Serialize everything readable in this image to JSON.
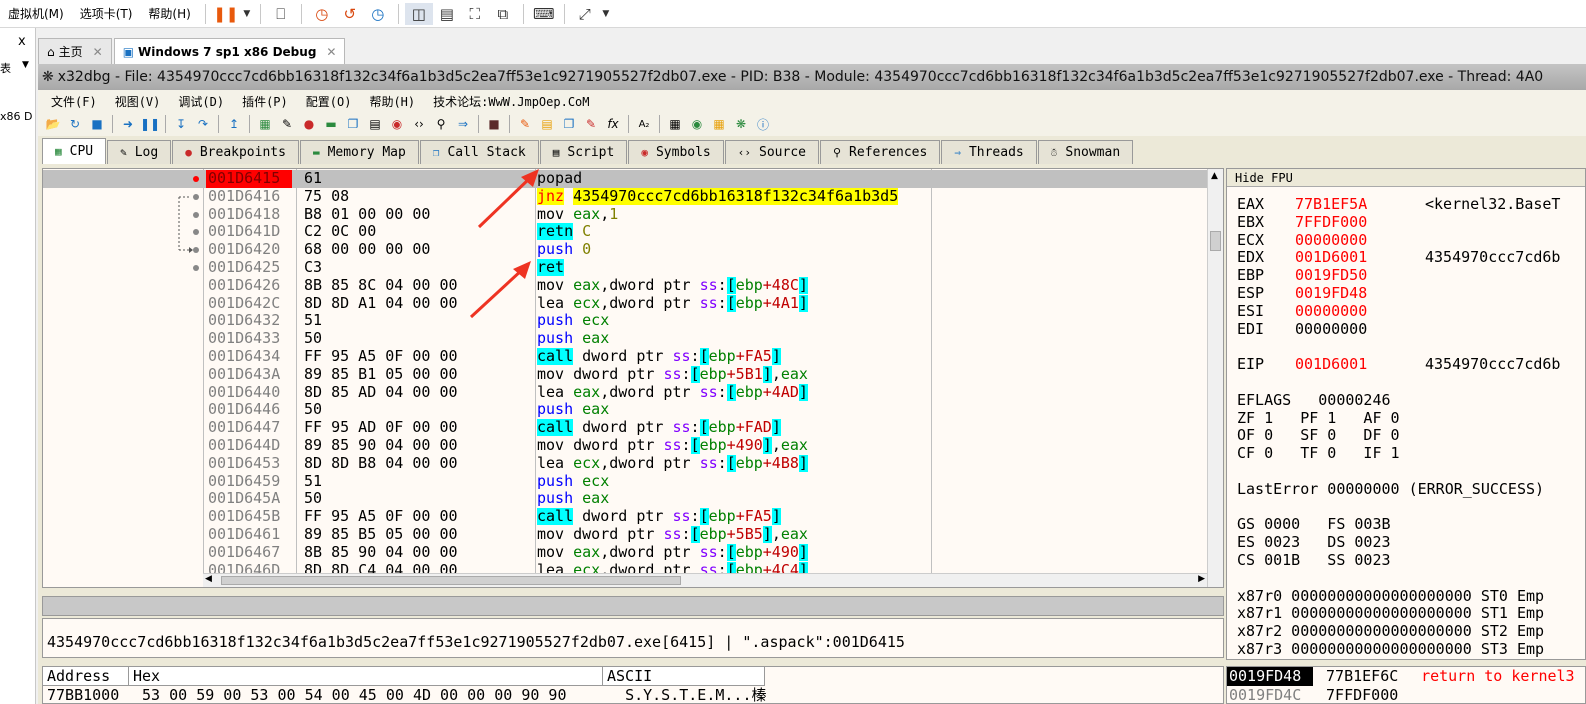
{
  "vm": {
    "menu": [
      "虚拟机(M)",
      "选项卡(T)",
      "帮助(H)"
    ],
    "tabs": [
      {
        "label": "主页"
      },
      {
        "label": "Windows 7 sp1 x86 Debug"
      }
    ],
    "left_labels": [
      "x",
      "表",
      "x86 D"
    ]
  },
  "window": {
    "title": "x32dbg - File: 4354970ccc7cd6bb16318f132c34f6a1b3d5c2ea7ff53e1c9271905527f2db07.exe - PID: B38 - Module: 4354970ccc7cd6bb16318f132c34f6a1b3d5c2ea7ff53e1c9271905527f2db07.exe - Thread: 4A0"
  },
  "menu": [
    "文件(F)",
    "视图(V)",
    "调试(D)",
    "插件(P)",
    "配置(O)",
    "帮助(H)",
    "技术论坛:WwW.JmpOep.CoM"
  ],
  "tabs": [
    {
      "label": "CPU",
      "active": true
    },
    {
      "label": "Log"
    },
    {
      "label": "Breakpoints"
    },
    {
      "label": "Memory Map"
    },
    {
      "label": "Call Stack"
    },
    {
      "label": "Script"
    },
    {
      "label": "Symbols"
    },
    {
      "label": "Source"
    },
    {
      "label": "References"
    },
    {
      "label": "Threads"
    },
    {
      "label": "Snowman"
    }
  ],
  "disasm": [
    {
      "addr": "001D6415",
      "bytes": "61",
      "parts": [
        [
          "op",
          "popad"
        ]
      ],
      "current": true
    },
    {
      "addr": "001D6416",
      "bytes": "75 08",
      "parts": [
        [
          "jcc",
          "jnz"
        ],
        [
          "sp",
          " "
        ],
        [
          "tgt",
          "4354970ccc7cd6bb16318f132c34f6a1b3d5"
        ]
      ]
    },
    {
      "addr": "001D6418",
      "bytes": "B8 01 00 00 00",
      "parts": [
        [
          "op",
          "mov "
        ],
        [
          "reg",
          "eax"
        ],
        [
          "op",
          ","
        ],
        [
          "imm",
          "1"
        ]
      ]
    },
    {
      "addr": "001D641D",
      "bytes": "C2 0C 00",
      "parts": [
        [
          "ret",
          "retn"
        ],
        [
          "op",
          " "
        ],
        [
          "imm",
          "C"
        ]
      ]
    },
    {
      "addr": "001D6420",
      "bytes": "68 00 00 00 00",
      "parts": [
        [
          "push",
          "push"
        ],
        [
          "op",
          " "
        ],
        [
          "imm",
          "0"
        ]
      ]
    },
    {
      "addr": "001D6425",
      "bytes": "C3",
      "parts": [
        [
          "ret",
          "ret"
        ]
      ]
    },
    {
      "addr": "001D6426",
      "bytes": "8B 85 8C 04 00 00",
      "parts": [
        [
          "op",
          "mov "
        ],
        [
          "reg",
          "eax"
        ],
        [
          "op",
          ",dword ptr "
        ],
        [
          "seg",
          "ss"
        ],
        [
          "op",
          ":"
        ],
        [
          "brk",
          "["
        ],
        [
          "reg",
          "ebp"
        ],
        [
          "off",
          "+48C"
        ],
        [
          "brk",
          "]"
        ]
      ]
    },
    {
      "addr": "001D642C",
      "bytes": "8D 8D A1 04 00 00",
      "parts": [
        [
          "op",
          "lea "
        ],
        [
          "reg",
          "ecx"
        ],
        [
          "op",
          ",dword ptr "
        ],
        [
          "seg",
          "ss"
        ],
        [
          "op",
          ":"
        ],
        [
          "brk",
          "["
        ],
        [
          "reg",
          "ebp"
        ],
        [
          "off",
          "+4A1"
        ],
        [
          "brk",
          "]"
        ]
      ]
    },
    {
      "addr": "001D6432",
      "bytes": "51",
      "parts": [
        [
          "push",
          "push"
        ],
        [
          "op",
          " "
        ],
        [
          "reg",
          "ecx"
        ]
      ]
    },
    {
      "addr": "001D6433",
      "bytes": "50",
      "parts": [
        [
          "push",
          "push"
        ],
        [
          "op",
          " "
        ],
        [
          "reg",
          "eax"
        ]
      ]
    },
    {
      "addr": "001D6434",
      "bytes": "FF 95 A5 0F 00 00",
      "parts": [
        [
          "call",
          "call"
        ],
        [
          "op",
          " dword ptr "
        ],
        [
          "seg",
          "ss"
        ],
        [
          "op",
          ":"
        ],
        [
          "brk",
          "["
        ],
        [
          "reg",
          "ebp"
        ],
        [
          "off",
          "+FA5"
        ],
        [
          "brk",
          "]"
        ]
      ]
    },
    {
      "addr": "001D643A",
      "bytes": "89 85 B1 05 00 00",
      "parts": [
        [
          "op",
          "mov dword ptr "
        ],
        [
          "seg",
          "ss"
        ],
        [
          "op",
          ":"
        ],
        [
          "brk",
          "["
        ],
        [
          "reg",
          "ebp"
        ],
        [
          "off",
          "+5B1"
        ],
        [
          "brk",
          "]"
        ],
        [
          "op",
          ","
        ],
        [
          "reg",
          "eax"
        ]
      ]
    },
    {
      "addr": "001D6440",
      "bytes": "8D 85 AD 04 00 00",
      "parts": [
        [
          "op",
          "lea "
        ],
        [
          "reg",
          "eax"
        ],
        [
          "op",
          ",dword ptr "
        ],
        [
          "seg",
          "ss"
        ],
        [
          "op",
          ":"
        ],
        [
          "brk",
          "["
        ],
        [
          "reg",
          "ebp"
        ],
        [
          "off",
          "+4AD"
        ],
        [
          "brk",
          "]"
        ]
      ]
    },
    {
      "addr": "001D6446",
      "bytes": "50",
      "parts": [
        [
          "push",
          "push"
        ],
        [
          "op",
          " "
        ],
        [
          "reg",
          "eax"
        ]
      ]
    },
    {
      "addr": "001D6447",
      "bytes": "FF 95 AD 0F 00 00",
      "parts": [
        [
          "call",
          "call"
        ],
        [
          "op",
          " dword ptr "
        ],
        [
          "seg",
          "ss"
        ],
        [
          "op",
          ":"
        ],
        [
          "brk",
          "["
        ],
        [
          "reg",
          "ebp"
        ],
        [
          "off",
          "+FAD"
        ],
        [
          "brk",
          "]"
        ]
      ]
    },
    {
      "addr": "001D644D",
      "bytes": "89 85 90 04 00 00",
      "parts": [
        [
          "op",
          "mov dword ptr "
        ],
        [
          "seg",
          "ss"
        ],
        [
          "op",
          ":"
        ],
        [
          "brk",
          "["
        ],
        [
          "reg",
          "ebp"
        ],
        [
          "off",
          "+490"
        ],
        [
          "brk",
          "]"
        ],
        [
          "op",
          ","
        ],
        [
          "reg",
          "eax"
        ]
      ]
    },
    {
      "addr": "001D6453",
      "bytes": "8D 8D B8 04 00 00",
      "parts": [
        [
          "op",
          "lea "
        ],
        [
          "reg",
          "ecx"
        ],
        [
          "op",
          ",dword ptr "
        ],
        [
          "seg",
          "ss"
        ],
        [
          "op",
          ":"
        ],
        [
          "brk",
          "["
        ],
        [
          "reg",
          "ebp"
        ],
        [
          "off",
          "+4B8"
        ],
        [
          "brk",
          "]"
        ]
      ]
    },
    {
      "addr": "001D6459",
      "bytes": "51",
      "parts": [
        [
          "push",
          "push"
        ],
        [
          "op",
          " "
        ],
        [
          "reg",
          "ecx"
        ]
      ]
    },
    {
      "addr": "001D645A",
      "bytes": "50",
      "parts": [
        [
          "push",
          "push"
        ],
        [
          "op",
          " "
        ],
        [
          "reg",
          "eax"
        ]
      ]
    },
    {
      "addr": "001D645B",
      "bytes": "FF 95 A5 0F 00 00",
      "parts": [
        [
          "call",
          "call"
        ],
        [
          "op",
          " dword ptr "
        ],
        [
          "seg",
          "ss"
        ],
        [
          "op",
          ":"
        ],
        [
          "brk",
          "["
        ],
        [
          "reg",
          "ebp"
        ],
        [
          "off",
          "+FA5"
        ],
        [
          "brk",
          "]"
        ]
      ]
    },
    {
      "addr": "001D6461",
      "bytes": "89 85 B5 05 00 00",
      "parts": [
        [
          "op",
          "mov dword ptr "
        ],
        [
          "seg",
          "ss"
        ],
        [
          "op",
          ":"
        ],
        [
          "brk",
          "["
        ],
        [
          "reg",
          "ebp"
        ],
        [
          "off",
          "+5B5"
        ],
        [
          "brk",
          "]"
        ],
        [
          "op",
          ","
        ],
        [
          "reg",
          "eax"
        ]
      ]
    },
    {
      "addr": "001D6467",
      "bytes": "8B 85 90 04 00 00",
      "parts": [
        [
          "op",
          "mov "
        ],
        [
          "reg",
          "eax"
        ],
        [
          "op",
          ",dword ptr "
        ],
        [
          "seg",
          "ss"
        ],
        [
          "op",
          ":"
        ],
        [
          "brk",
          "["
        ],
        [
          "reg",
          "ebp"
        ],
        [
          "off",
          "+490"
        ],
        [
          "brk",
          "]"
        ]
      ]
    },
    {
      "addr": "001D646D",
      "bytes": "8D 8D C4 04 00 00",
      "parts": [
        [
          "op",
          "lea "
        ],
        [
          "reg",
          "ecx"
        ],
        [
          "op",
          ",dword ptr "
        ],
        [
          "seg",
          "ss"
        ],
        [
          "op",
          ":"
        ],
        [
          "brk",
          "["
        ],
        [
          "reg",
          "ebp"
        ],
        [
          "off",
          "+4C4"
        ],
        [
          "brk",
          "]"
        ]
      ]
    }
  ],
  "registers": {
    "header": "Hide FPU",
    "gp": [
      {
        "name": "EAX",
        "value": "77B1EF5A",
        "comment": "<kernel32.BaseT",
        "red": true
      },
      {
        "name": "EBX",
        "value": "7FFDF000",
        "comment": "",
        "red": true
      },
      {
        "name": "ECX",
        "value": "00000000",
        "comment": "",
        "red": true
      },
      {
        "name": "EDX",
        "value": "001D6001",
        "comment": "4354970ccc7cd6b",
        "red": true
      },
      {
        "name": "EBP",
        "value": "0019FD50",
        "comment": "",
        "red": true
      },
      {
        "name": "ESP",
        "value": "0019FD48",
        "comment": "",
        "red": true
      },
      {
        "name": "ESI",
        "value": "00000000",
        "comment": "",
        "red": true
      },
      {
        "name": "EDI",
        "value": "00000000",
        "comment": "",
        "red": false
      }
    ],
    "eip": {
      "name": "EIP",
      "value": "001D6001",
      "comment": "4354970ccc7cd6b"
    },
    "eflags": "EFLAGS   00000246",
    "flags": [
      "ZF 1   PF 1   AF 0",
      "OF 0   SF 0   DF 0",
      "CF 0   TF 0   IF 1"
    ],
    "lasterror": "LastError 00000000 (ERROR_SUCCESS)",
    "segs": [
      "GS 0000   FS 003B",
      "ES 0023   DS 0023",
      "CS 001B   SS 0023"
    ],
    "fpu": [
      "x87r0 00000000000000000000 ST0 Emp",
      "x87r1 00000000000000000000 ST1 Emp",
      "x87r2 00000000000000000000 ST2 Emp",
      "x87r3 00000000000000000000 ST3 Emp"
    ]
  },
  "info": "4354970ccc7cd6bb16318f132c34f6a1b3d5c2ea7ff53e1c9271905527f2db07.exe[6415] | \".aspack\":001D6415",
  "dump": {
    "headers": [
      "Address",
      "Hex",
      "ASCII"
    ],
    "row": {
      "addr": "77BB1000",
      "hex": "53 00 59 00 53 00 54 00 45 00 4D 00 00 00 90 90",
      "ascii": "S.Y.S.T.E.M...榛"
    }
  },
  "stack": [
    {
      "addr": "0019FD48",
      "value": "77B1EF6C",
      "comment": "return to kernel3"
    },
    {
      "addr": "0019FD4C",
      "value": "7FFDF000",
      "comment": ""
    }
  ]
}
